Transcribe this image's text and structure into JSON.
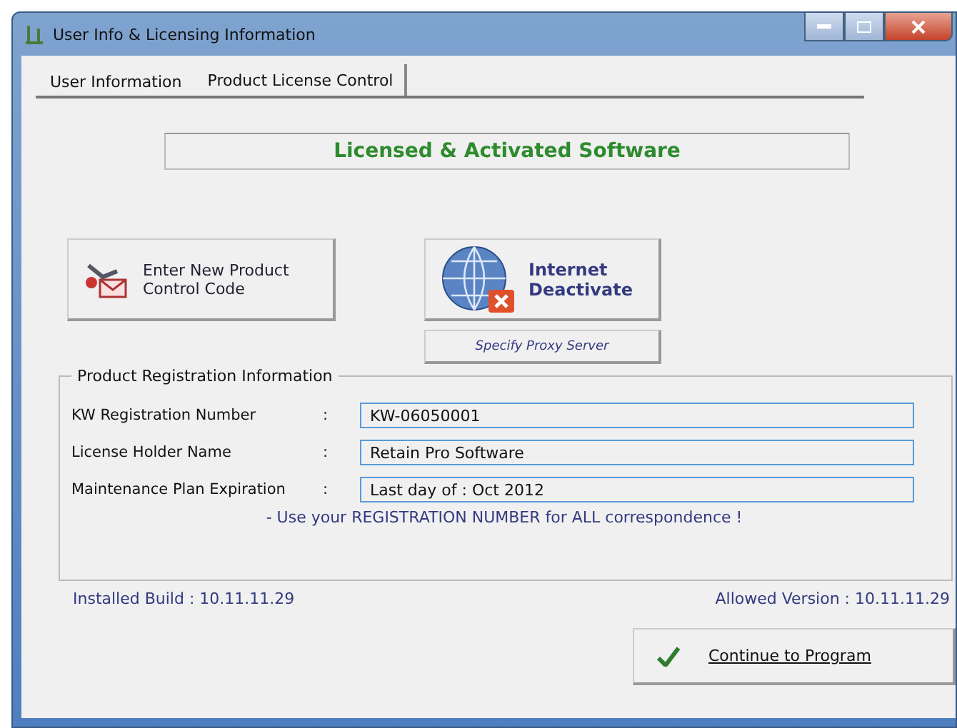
{
  "window": {
    "title": "User Info & Licensing Information"
  },
  "tabs": [
    {
      "label": "User Information",
      "selected": false
    },
    {
      "label": "Product License Control",
      "selected": true
    }
  ],
  "status_banner": "Licensed & Activated Software",
  "actions": [
    {
      "kind": "code",
      "lines": [
        "Enter New Product",
        "Control Code"
      ]
    },
    {
      "kind": "deactivate",
      "lines": [
        "Internet",
        "Deactivate"
      ]
    }
  ],
  "proxy_button": "Specify Proxy Server",
  "registration": {
    "title": "Product Registration Information",
    "fields": [
      {
        "label": "KW Registration Number",
        "separator": ":",
        "value": "KW-06050001"
      },
      {
        "label": "License Holder Name",
        "separator": ":",
        "value": "Retain Pro Software"
      },
      {
        "label": "Maintenance Plan Expiration",
        "separator": ":",
        "value": "Last day of : Oct 2012"
      }
    ],
    "note": "-  Use your REGISTRATION NUMBER for ALL correspondence !"
  },
  "installed_build": "Installed Build : 10.11.11.29",
  "allowed_version": "Allowed Version : 10.11.11.29",
  "continue_button": "Continue to Program"
}
